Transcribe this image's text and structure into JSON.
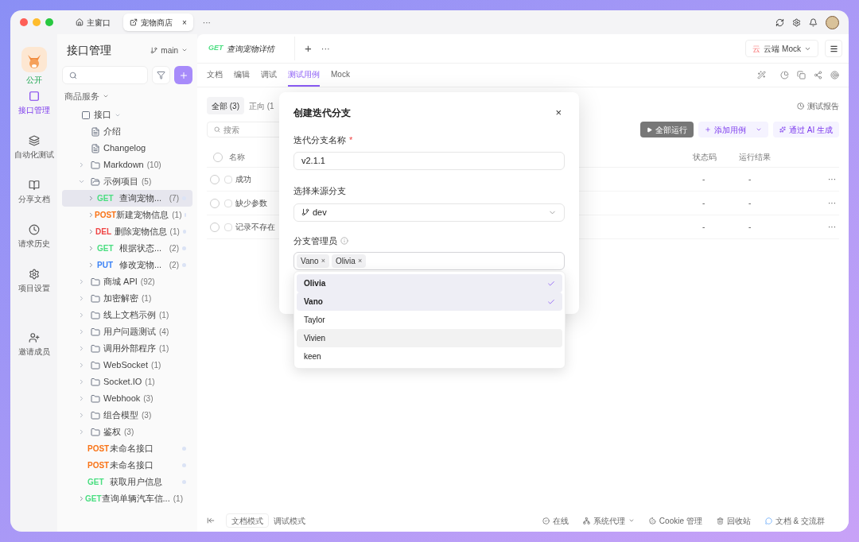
{
  "window": {
    "tabs": [
      {
        "label": "主窗口",
        "selected": false
      },
      {
        "label": "宠物商店",
        "selected": true,
        "close": "×"
      }
    ],
    "more": "···"
  },
  "rail": {
    "project_label": "公开",
    "items": [
      {
        "label": "接口管理",
        "selected": true
      },
      {
        "label": "自动化测试",
        "selected": false
      },
      {
        "label": "分享文档",
        "selected": false
      },
      {
        "label": "请求历史",
        "selected": false
      },
      {
        "label": "项目设置",
        "selected": false
      },
      {
        "label": "邀请成员",
        "selected": false
      }
    ]
  },
  "tree_panel": {
    "title": "接口管理",
    "branch": "main",
    "section": "商品服务",
    "tree": [
      {
        "kind": "root",
        "label": "接口",
        "expanded": true,
        "children": [
          {
            "kind": "doc",
            "label": "介绍"
          },
          {
            "kind": "doc",
            "label": "Changelog"
          },
          {
            "kind": "folder",
            "label": "Markdown",
            "count": "(10)",
            "expanded": false
          },
          {
            "kind": "folder",
            "label": "示例项目",
            "count": "(5)",
            "expanded": true,
            "children": [
              {
                "kind": "endpoint",
                "method": "GET",
                "color": "#4ade80",
                "label": "查询宠物...",
                "count": "(7)",
                "selected": true,
                "chevron": true
              },
              {
                "kind": "endpoint",
                "method": "POST",
                "color": "#f97316",
                "label": "新建宠物信息",
                "count": "(1)",
                "selected": false,
                "chevron": true
              },
              {
                "kind": "endpoint",
                "method": "DEL",
                "color": "#ef4444",
                "label": "删除宠物信息",
                "count": "(1)",
                "selected": false,
                "chevron": true
              },
              {
                "kind": "endpoint",
                "method": "GET",
                "color": "#4ade80",
                "label": "根据状态...",
                "count": "(2)",
                "selected": false,
                "chevron": true
              },
              {
                "kind": "endpoint",
                "method": "PUT",
                "color": "#3b82f6",
                "label": "修改宠物...",
                "count": "(2)",
                "selected": false,
                "chevron": true
              }
            ]
          },
          {
            "kind": "folder",
            "label": "商城 API",
            "count": "(92)",
            "expanded": false
          },
          {
            "kind": "folder",
            "label": "加密解密",
            "count": "(1)",
            "expanded": false
          },
          {
            "kind": "folder",
            "label": "线上文档示例",
            "count": "(1)",
            "expanded": false
          },
          {
            "kind": "folder",
            "label": "用户问题测试",
            "count": "(4)",
            "expanded": false
          },
          {
            "kind": "folder",
            "label": "调用外部程序",
            "count": "(1)",
            "expanded": false
          },
          {
            "kind": "folder",
            "label": "WebSocket",
            "count": "(1)",
            "expanded": false
          },
          {
            "kind": "folder",
            "label": "Socket.IO",
            "count": "(1)",
            "expanded": false
          },
          {
            "kind": "folder",
            "label": "Webhook",
            "count": "(3)",
            "expanded": false
          },
          {
            "kind": "folder",
            "label": "组合模型",
            "count": "(3)",
            "expanded": false
          },
          {
            "kind": "folder",
            "label": "鉴权",
            "count": "(3)",
            "expanded": false
          },
          {
            "kind": "endpoint",
            "method": "POST",
            "color": "#f97316",
            "label": "未命名接口",
            "selected": false,
            "chevron": false
          },
          {
            "kind": "endpoint",
            "method": "POST",
            "color": "#f97316",
            "label": "未命名接口",
            "selected": false,
            "chevron": false
          },
          {
            "kind": "endpoint",
            "method": "GET",
            "color": "#4ade80",
            "label": "获取用户信息",
            "selected": false,
            "chevron": false
          },
          {
            "kind": "endpoint",
            "method": "GET",
            "color": "#4ade80",
            "label": "查询单辆汽车信...",
            "count": "(1)",
            "selected": false,
            "chevron": true
          }
        ]
      }
    ]
  },
  "main": {
    "endpoint_tab": {
      "method": "GET",
      "name": "查询宠物详情"
    },
    "add_tab": "+",
    "more": "···",
    "mock": {
      "badge": "云",
      "label": "云端 Mock"
    },
    "sub_tabs": [
      {
        "label": "文档",
        "selected": false
      },
      {
        "label": "编辑",
        "selected": false
      },
      {
        "label": "调试",
        "selected": false
      },
      {
        "label": "测试用例",
        "selected": true
      },
      {
        "label": "Mock",
        "selected": false
      }
    ],
    "filter_tabs": [
      {
        "label": "全部 (3)",
        "selected": true
      },
      {
        "label": "正向 (1",
        "selected": false
      }
    ],
    "report": "测试报告",
    "search": {
      "placeholder": "搜索"
    },
    "run_all": "全部运行",
    "add_case": "添加用例",
    "ai_generate": "通过 AI 生成",
    "table": {
      "all_checked": false,
      "columns": [
        "名称",
        "状态码",
        "运行结果"
      ],
      "rows": [
        {
          "checked": false,
          "name": "成功",
          "status": "-",
          "result": "-",
          "more": "···"
        },
        {
          "checked": false,
          "name": "缺少参数",
          "status": "-",
          "result": "-",
          "more": "···"
        },
        {
          "checked": false,
          "name": "记录不存在",
          "status": "-",
          "result": "-",
          "more": "···"
        }
      ]
    }
  },
  "footer": {
    "modes": [
      {
        "label": "文档模式",
        "selected": true
      },
      {
        "label": "调试模式",
        "selected": false
      }
    ],
    "items": [
      "在线",
      "系统代理",
      "Cookie 管理",
      "回收站",
      "文档 & 交流群"
    ]
  },
  "dialog": {
    "title": "创建迭代分支",
    "close": "×",
    "name_label": "迭代分支名称",
    "required": "*",
    "name_value": "v2.1.1",
    "source_label": "选择来源分支",
    "source_value": "dev",
    "managers_label": "分支管理员",
    "managers": [
      {
        "label": "Vano",
        "remove": "×"
      },
      {
        "label": "Olivia",
        "remove": "×"
      }
    ],
    "options": [
      {
        "label": "Olivia",
        "selected": true,
        "hovered": false
      },
      {
        "label": "Vano",
        "selected": true,
        "hovered": false
      },
      {
        "label": "Taylor",
        "selected": false,
        "hovered": false
      },
      {
        "label": "Vivien",
        "selected": false,
        "hovered": true
      },
      {
        "label": "keen",
        "selected": false,
        "hovered": false
      }
    ]
  }
}
